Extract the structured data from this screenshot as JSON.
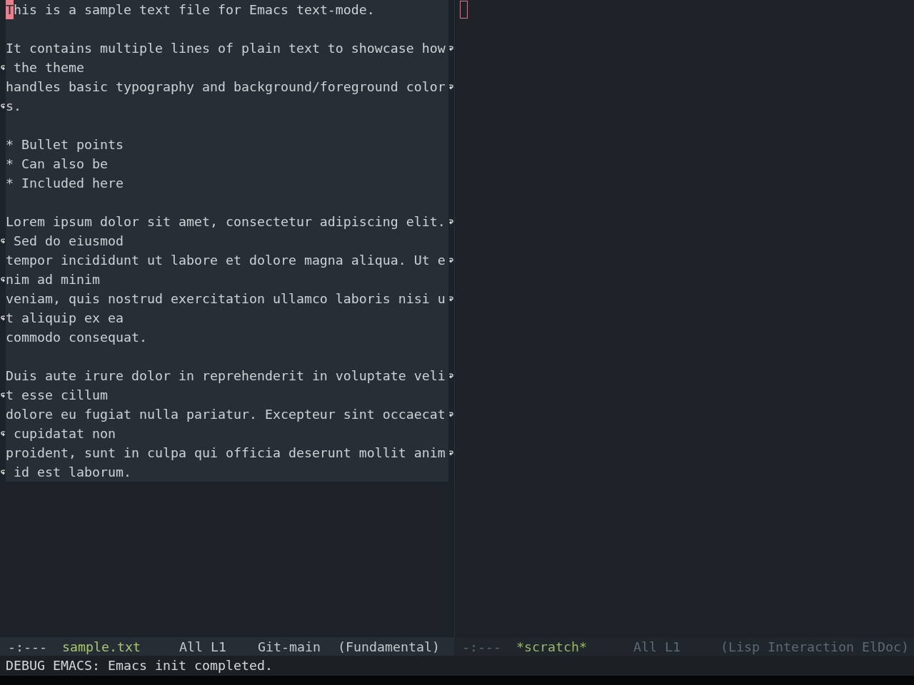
{
  "windows": [
    {
      "selected": true,
      "paragraphs": [
        {
          "lines": [
            {
              "rows": [
                "This is a sample text file for Emacs text-mode."
              ]
            }
          ]
        },
        {
          "lines": [
            {
              "rows": [
                "It contains multiple lines of plain text to showcase how",
                " the theme"
              ]
            },
            {
              "rows": [
                "handles basic typography and background/foreground color",
                "s."
              ]
            }
          ]
        },
        {
          "lines": [
            {
              "rows": [
                "* Bullet points"
              ]
            },
            {
              "rows": [
                "* Can also be"
              ]
            },
            {
              "rows": [
                "* Included here"
              ]
            }
          ]
        },
        {
          "lines": [
            {
              "rows": [
                "Lorem ipsum dolor sit amet, consectetur adipiscing elit.",
                " Sed do eiusmod"
              ]
            },
            {
              "rows": [
                "tempor incididunt ut labore et dolore magna aliqua. Ut e",
                "nim ad minim"
              ]
            },
            {
              "rows": [
                "veniam, quis nostrud exercitation ullamco laboris nisi u",
                "t aliquip ex ea"
              ]
            },
            {
              "rows": [
                "commodo consequat."
              ]
            }
          ]
        },
        {
          "lines": [
            {
              "rows": [
                "Duis aute irure dolor in reprehenderit in voluptate veli",
                "t esse cillum"
              ]
            },
            {
              "rows": [
                "dolore eu fugiat nulla pariatur. Excepteur sint occaecat",
                " cupidatat non"
              ]
            },
            {
              "rows": [
                "proident, sunt in culpa qui officia deserunt mollit anim",
                " id est laborum."
              ]
            }
          ]
        }
      ],
      "mode_line": {
        "state": "-:---",
        "buffer_name": "sample.txt",
        "position": "All L1",
        "vc_branch": "Git-main",
        "major_mode": "(Fundamental)"
      }
    },
    {
      "selected": false,
      "mode_line": {
        "state": "-:---",
        "buffer_name": "*scratch*",
        "position": "All L1",
        "major_mode": "(Lisp Interaction ElDoc)"
      }
    }
  ],
  "echo_area": {
    "message": "DEBUG EMACS: Emacs init completed."
  }
}
